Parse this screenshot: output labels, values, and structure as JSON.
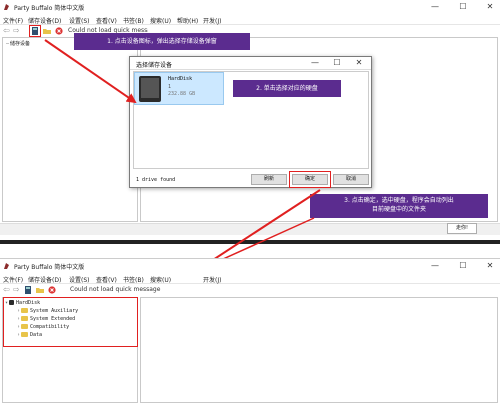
{
  "top_window": {
    "title": "Party Buffalo 简体中文版",
    "menu": [
      "文件(F)",
      "储存设备(D)",
      "设置(S)",
      "查看(V)",
      "书签(B)",
      "搜索(U)",
      "帮助(H)",
      "开发(J)"
    ],
    "toolbar_status": "Could not load quick message",
    "tree_root": "储存设备",
    "status_button": "走你!"
  },
  "dialog": {
    "title": "选择储存设备",
    "device_name": "HardDisk",
    "device_index": "1",
    "device_size": "232.88 GB",
    "drives_found": "1 drive found",
    "refresh_button": "刷新",
    "ok_button": "确定",
    "cancel_button": "取消"
  },
  "callouts": {
    "step1": "1. 点击设备图标，弹出选择存储设备弹窗",
    "step2": "2. 单击选择对应的硬盘",
    "step3_line1": "3. 点击确定，选中硬盘，程序会自动列出",
    "step3_line2": "目前硬盘中的文件夹"
  },
  "bottom_window": {
    "title": "Party Buffalo 简体中文版",
    "menu": [
      "文件(F)",
      "储存设备(D)",
      "设置(S)",
      "查看(V)",
      "书签(B)",
      "搜索(U)",
      "开发(J)"
    ],
    "toolbar_status": "Could not load quick message",
    "tree_root": "HardDisk",
    "tree_children": [
      "System Auxiliary",
      "System Extended",
      "Compatibility",
      "Data"
    ]
  },
  "colors": {
    "callout_bg": "#5b2c8f",
    "highlight_red": "#e02020",
    "selection_blue": "#cce8ff",
    "folder_yellow": "#e8c44a"
  }
}
